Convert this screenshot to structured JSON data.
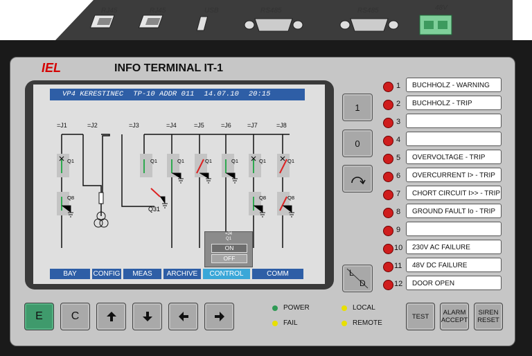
{
  "ports": [
    "RJ45",
    "RJ45",
    "USB",
    "RS485",
    "RS485",
    "48V"
  ],
  "brand": "IEL",
  "title": "INFO TERMINAL  IT-1",
  "screen": {
    "header": [
      "VP4 KERESTINEC",
      "TP-10 ADDR 011",
      "14.07.10",
      "20:15"
    ],
    "bays": [
      "=J1",
      "=J2",
      "=J3",
      "=J4",
      "=J5",
      "=J6",
      "=J7",
      "=J8"
    ],
    "q1": "Q1",
    "q8": "Q8",
    "q31": "Q31",
    "tabs": [
      "BAY",
      "CONFIG",
      "MEAS",
      "ARCHIVE",
      "CONTROL",
      "COMM"
    ],
    "active_tab": "CONTROL",
    "popup": {
      "bay": "=J4",
      "device": "Q1",
      "on_label": "ON",
      "off_label": "OFF"
    }
  },
  "side_buttons": {
    "one": "1",
    "zero": "0",
    "local_l": "L",
    "local_d": "D"
  },
  "alarms": [
    {
      "num": "1",
      "text": "BUCHHOLZ - WARNING"
    },
    {
      "num": "2",
      "text": "BUCHHOLZ - TRIP"
    },
    {
      "num": "3",
      "text": ""
    },
    {
      "num": "4",
      "text": ""
    },
    {
      "num": "5",
      "text": "OVERVOLTAGE - TRIP"
    },
    {
      "num": "6",
      "text": "OVERCURRENT I> - TRIP"
    },
    {
      "num": "7",
      "text": "CHORT CIRCUIT I>> - TRIP"
    },
    {
      "num": "8",
      "text": "GROUND FAULT Io - TRIP"
    },
    {
      "num": "9",
      "text": ""
    },
    {
      "num": "10",
      "text": "230V AC FAILURE"
    },
    {
      "num": "11",
      "text": "48V DC FAILURE"
    },
    {
      "num": "12",
      "text": "DOOR OPEN"
    }
  ],
  "keys": {
    "e": "E",
    "c": "C"
  },
  "status": {
    "power": "POWER",
    "fail": "FAIL",
    "local": "LOCAL",
    "remote": "REMOTE",
    "colors": {
      "power": "#2f9a55",
      "fail": "#e8e000",
      "local": "#e8e000",
      "remote": "#e8e000"
    }
  },
  "function_buttons": {
    "test": "TEST",
    "alarm_accept_1": "ALARM",
    "alarm_accept_2": "ACCEPT",
    "siren_reset_1": "SIREN",
    "siren_reset_2": "RESET"
  },
  "colors": {
    "brand": "#d40000",
    "screen_header": "#2e5ea6",
    "tab_active": "#3aa7d8",
    "led": "#cf1d1d",
    "e_key": "#3f9a6c"
  }
}
